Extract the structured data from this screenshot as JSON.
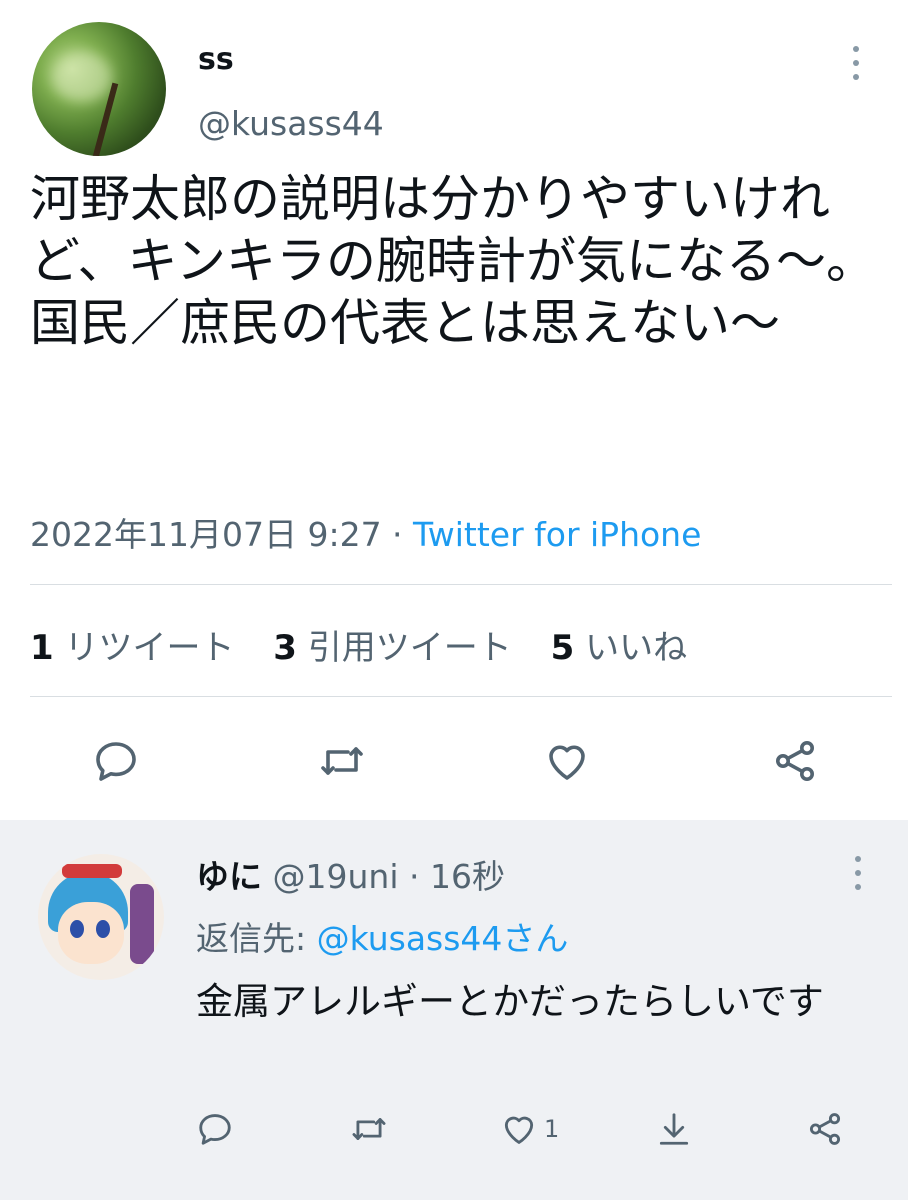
{
  "main_tweet": {
    "display_name": "ss",
    "handle": "@kusass44",
    "text": "河野太郎の説明は分かりやすいけれど、キンキラの腕時計が気になる〜。国民／庶民の代表とは思えない〜",
    "timestamp": "2022年11月07日 9:27",
    "separator": " · ",
    "source": "Twitter for iPhone",
    "stats": [
      {
        "count": "1",
        "label": "リツイート"
      },
      {
        "count": "3",
        "label": "引用ツイート"
      },
      {
        "count": "5",
        "label": "いいね"
      }
    ],
    "icons": [
      "reply-icon",
      "retweet-icon",
      "like-icon",
      "share-icon",
      "more-icon"
    ]
  },
  "reply_tweet": {
    "display_name": "ゆに",
    "handle": "@19uni",
    "time_separator": " · ",
    "time": "16秒",
    "reply_to_prefix": "返信先: ",
    "reply_to_mention": "@kusass44さん",
    "text": "金属アレルギーとかだったらしいです",
    "like_count": "1",
    "icons": [
      "reply-icon",
      "retweet-icon",
      "like-icon",
      "download-icon",
      "share-icon",
      "more-icon"
    ]
  },
  "colors": {
    "accent": "#1d9bf0",
    "secondary_text": "#536471",
    "reply_background": "#eff1f4"
  }
}
